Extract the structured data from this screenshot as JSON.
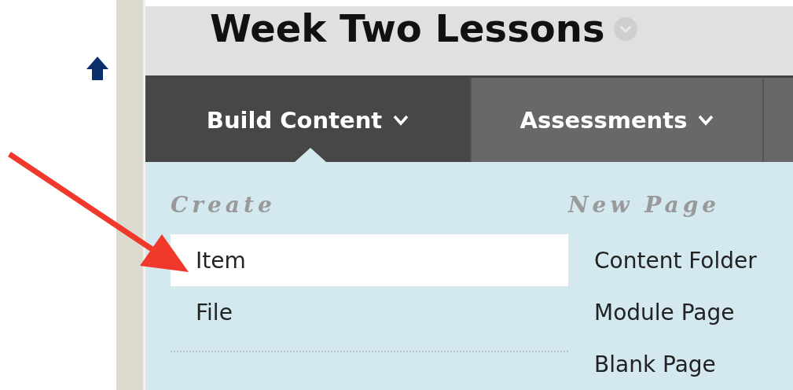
{
  "page_title": "Week Two Lessons",
  "tabs": [
    {
      "label": "Build Content",
      "selected": true
    },
    {
      "label": "Assessments",
      "selected": false
    },
    {
      "selected": false
    }
  ],
  "menu": {
    "columns": [
      {
        "heading": "Create",
        "items": [
          {
            "label": "Item",
            "selected": true
          },
          {
            "label": "File",
            "selected": false
          }
        ]
      },
      {
        "heading": "New Page",
        "items": [
          {
            "label": "Content Folder",
            "selected": false
          },
          {
            "label": "Module Page",
            "selected": false
          },
          {
            "label": "Blank Page",
            "selected": false
          }
        ]
      }
    ]
  }
}
